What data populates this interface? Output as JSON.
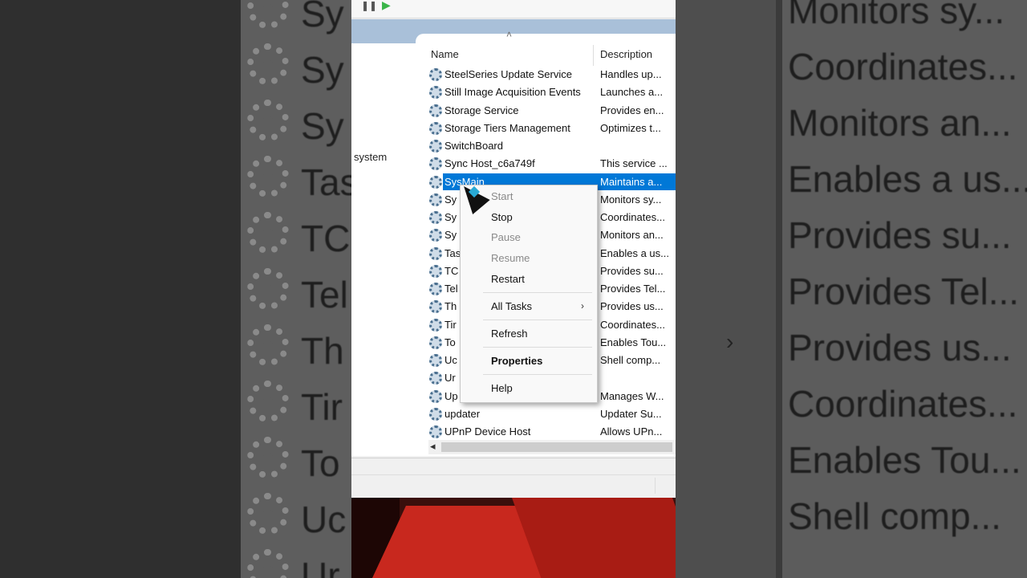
{
  "background": {
    "left_rows": [
      "Sy",
      "Sy",
      "Sy",
      "Tas",
      "TC",
      "Tel",
      "Th",
      "Tir",
      "To",
      "Uc",
      "Ur"
    ],
    "right_rows": [
      "Monitors sy...",
      "Coordinates...",
      "Monitors an...",
      "Enables a us...",
      "Provides su...",
      "Provides Tel...",
      "Provides us...",
      "Coordinates...",
      "Enables Tou...",
      "Shell comp..."
    ]
  },
  "left_pane": {
    "text": "system"
  },
  "columns": {
    "name": "Name",
    "description": "Description"
  },
  "services": [
    {
      "name": "SteelSeries Update Service",
      "description": "Handles up..."
    },
    {
      "name": "Still Image Acquisition Events",
      "description": "Launches a..."
    },
    {
      "name": "Storage Service",
      "description": "Provides en..."
    },
    {
      "name": "Storage Tiers Management",
      "description": "Optimizes t..."
    },
    {
      "name": "SwitchBoard",
      "description": ""
    },
    {
      "name": "Sync Host_c6a749f",
      "description": "This service ..."
    },
    {
      "name": "SysMain",
      "description": "Maintains a...",
      "selected": true
    },
    {
      "name": "Sy",
      "description": "Monitors sy..."
    },
    {
      "name": "Sy",
      "description": "Coordinates..."
    },
    {
      "name": "Sy",
      "description": "Monitors an..."
    },
    {
      "name": "Tas",
      "description": "Enables a us..."
    },
    {
      "name": "TC",
      "description": "Provides su..."
    },
    {
      "name": "Tel",
      "description": "Provides Tel..."
    },
    {
      "name": "Th",
      "description": "Provides us..."
    },
    {
      "name": "Tir",
      "description": "Coordinates..."
    },
    {
      "name": "To",
      "description": "Enables Tou..."
    },
    {
      "name": "Uc",
      "description": "Shell comp..."
    },
    {
      "name": "Ur",
      "description": ""
    },
    {
      "name": "Up",
      "description": "Manages W..."
    },
    {
      "name": "updater",
      "description": "Updater Su..."
    },
    {
      "name": "UPnP Device Host",
      "description": "Allows UPn..."
    }
  ],
  "context_menu": {
    "start": "Start",
    "stop": "Stop",
    "pause": "Pause",
    "resume": "Resume",
    "restart": "Restart",
    "all_tasks": "All Tasks",
    "refresh": "Refresh",
    "properties": "Properties",
    "help": "Help"
  },
  "colors": {
    "selection": "#0078d7",
    "header_band": "#a9c0d9"
  }
}
